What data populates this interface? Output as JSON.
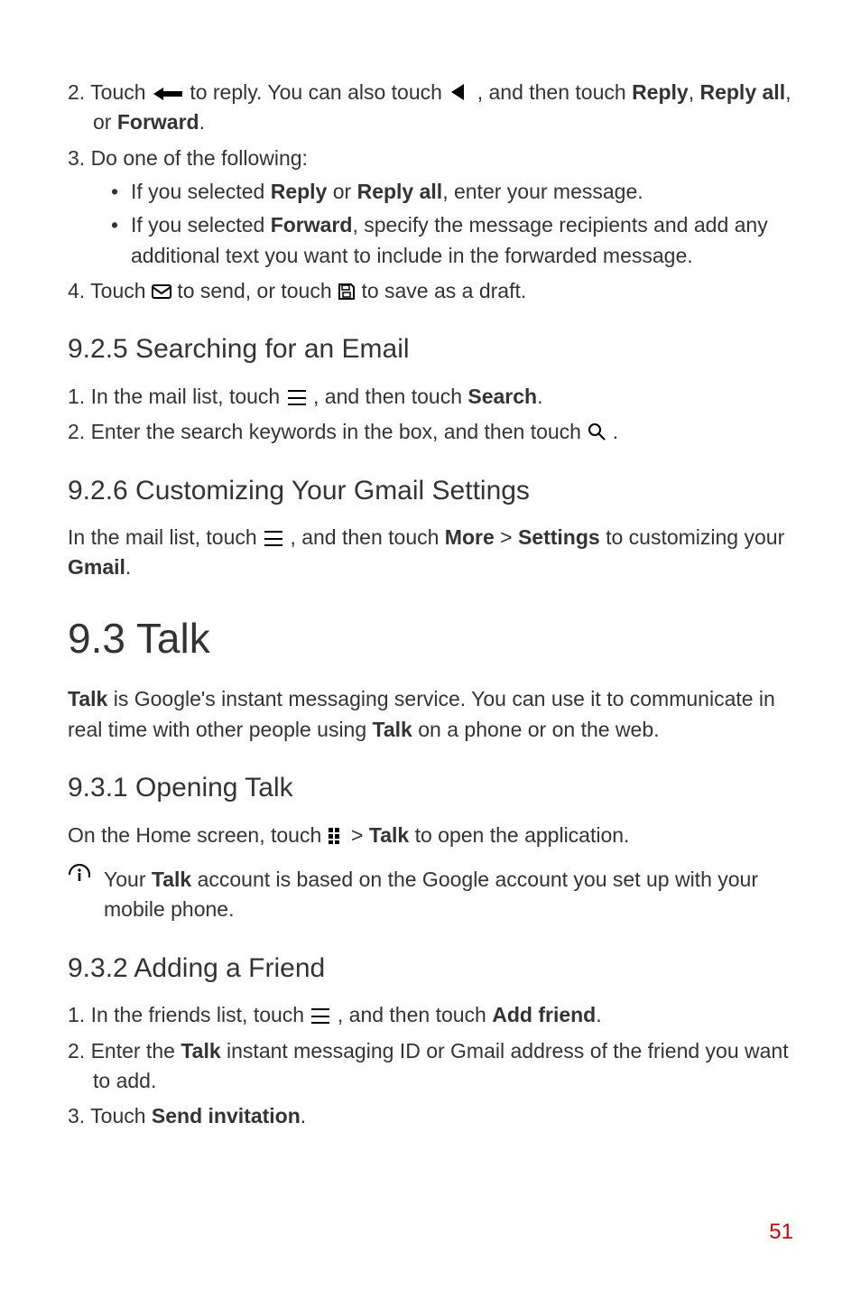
{
  "page_number": "51",
  "s1": {
    "step2": {
      "t1": "2. Touch",
      "t2": "to reply. You can also touch",
      "t3": ", and then touch ",
      "b1": "Reply",
      "comma1": ", ",
      "b2": "Reply all",
      "sep": ", or ",
      "b3": "Forward",
      "dot": "."
    },
    "step3": {
      "text": "3. Do one of the following:",
      "bullet1": {
        "pre": "If you selected ",
        "b1": "Reply",
        "mid": " or ",
        "b2": "Reply all",
        "post": ", enter your message."
      },
      "bullet2": {
        "pre": "If you selected ",
        "b1": "Forward",
        "post": ", specify the message recipients and add any additional text you want to include in the forwarded message."
      }
    },
    "step4": {
      "t1": "4. Touch",
      "t2": "to send, or touch",
      "t3": "to save as a draft."
    }
  },
  "s925": {
    "heading": "9.2.5  Searching for an Email",
    "step1": {
      "t1": "1. In the mail list, touch",
      "t2": ", and then touch ",
      "b": "Search",
      "dot": "."
    },
    "step2": {
      "t1": "2. Enter the search keywords in the box, and then touch",
      "dot": "."
    }
  },
  "s926": {
    "heading": "9.2.6  Customizing Your Gmail Settings",
    "para": {
      "t1": "In the mail list, touch",
      "t2": ", and then touch ",
      "b1": "More",
      "sep": " > ",
      "b2": "Settings",
      "t3": " to customizing your ",
      "b3": "Gmail",
      "dot": "."
    }
  },
  "s93": {
    "heading": "9.3  Talk",
    "intro": {
      "b1": "Talk",
      "t1": " is Google's instant messaging service. You can use it to communicate in real time with other people using ",
      "b2": "Talk",
      "t2": " on a phone or on the web."
    }
  },
  "s931": {
    "heading": "9.3.1  Opening Talk",
    "para": {
      "t1": "On the Home screen, touch",
      "t2": " > ",
      "b": "Talk",
      "t3": " to open the application."
    },
    "note": {
      "t1": "Your ",
      "b": "Talk",
      "t2": " account is based on the Google account you set up with your mobile phone."
    }
  },
  "s932": {
    "heading": "9.3.2  Adding a Friend",
    "step1": {
      "t1": "1. In the friends list, touch",
      "t2": ", and then touch ",
      "b": "Add friend",
      "dot": "."
    },
    "step2": {
      "t1": "2. Enter the ",
      "b": "Talk",
      "t2": " instant messaging ID or Gmail address of the friend you want to add."
    },
    "step3": {
      "t1": "3. Touch ",
      "b": "Send invitation",
      "dot": "."
    }
  }
}
